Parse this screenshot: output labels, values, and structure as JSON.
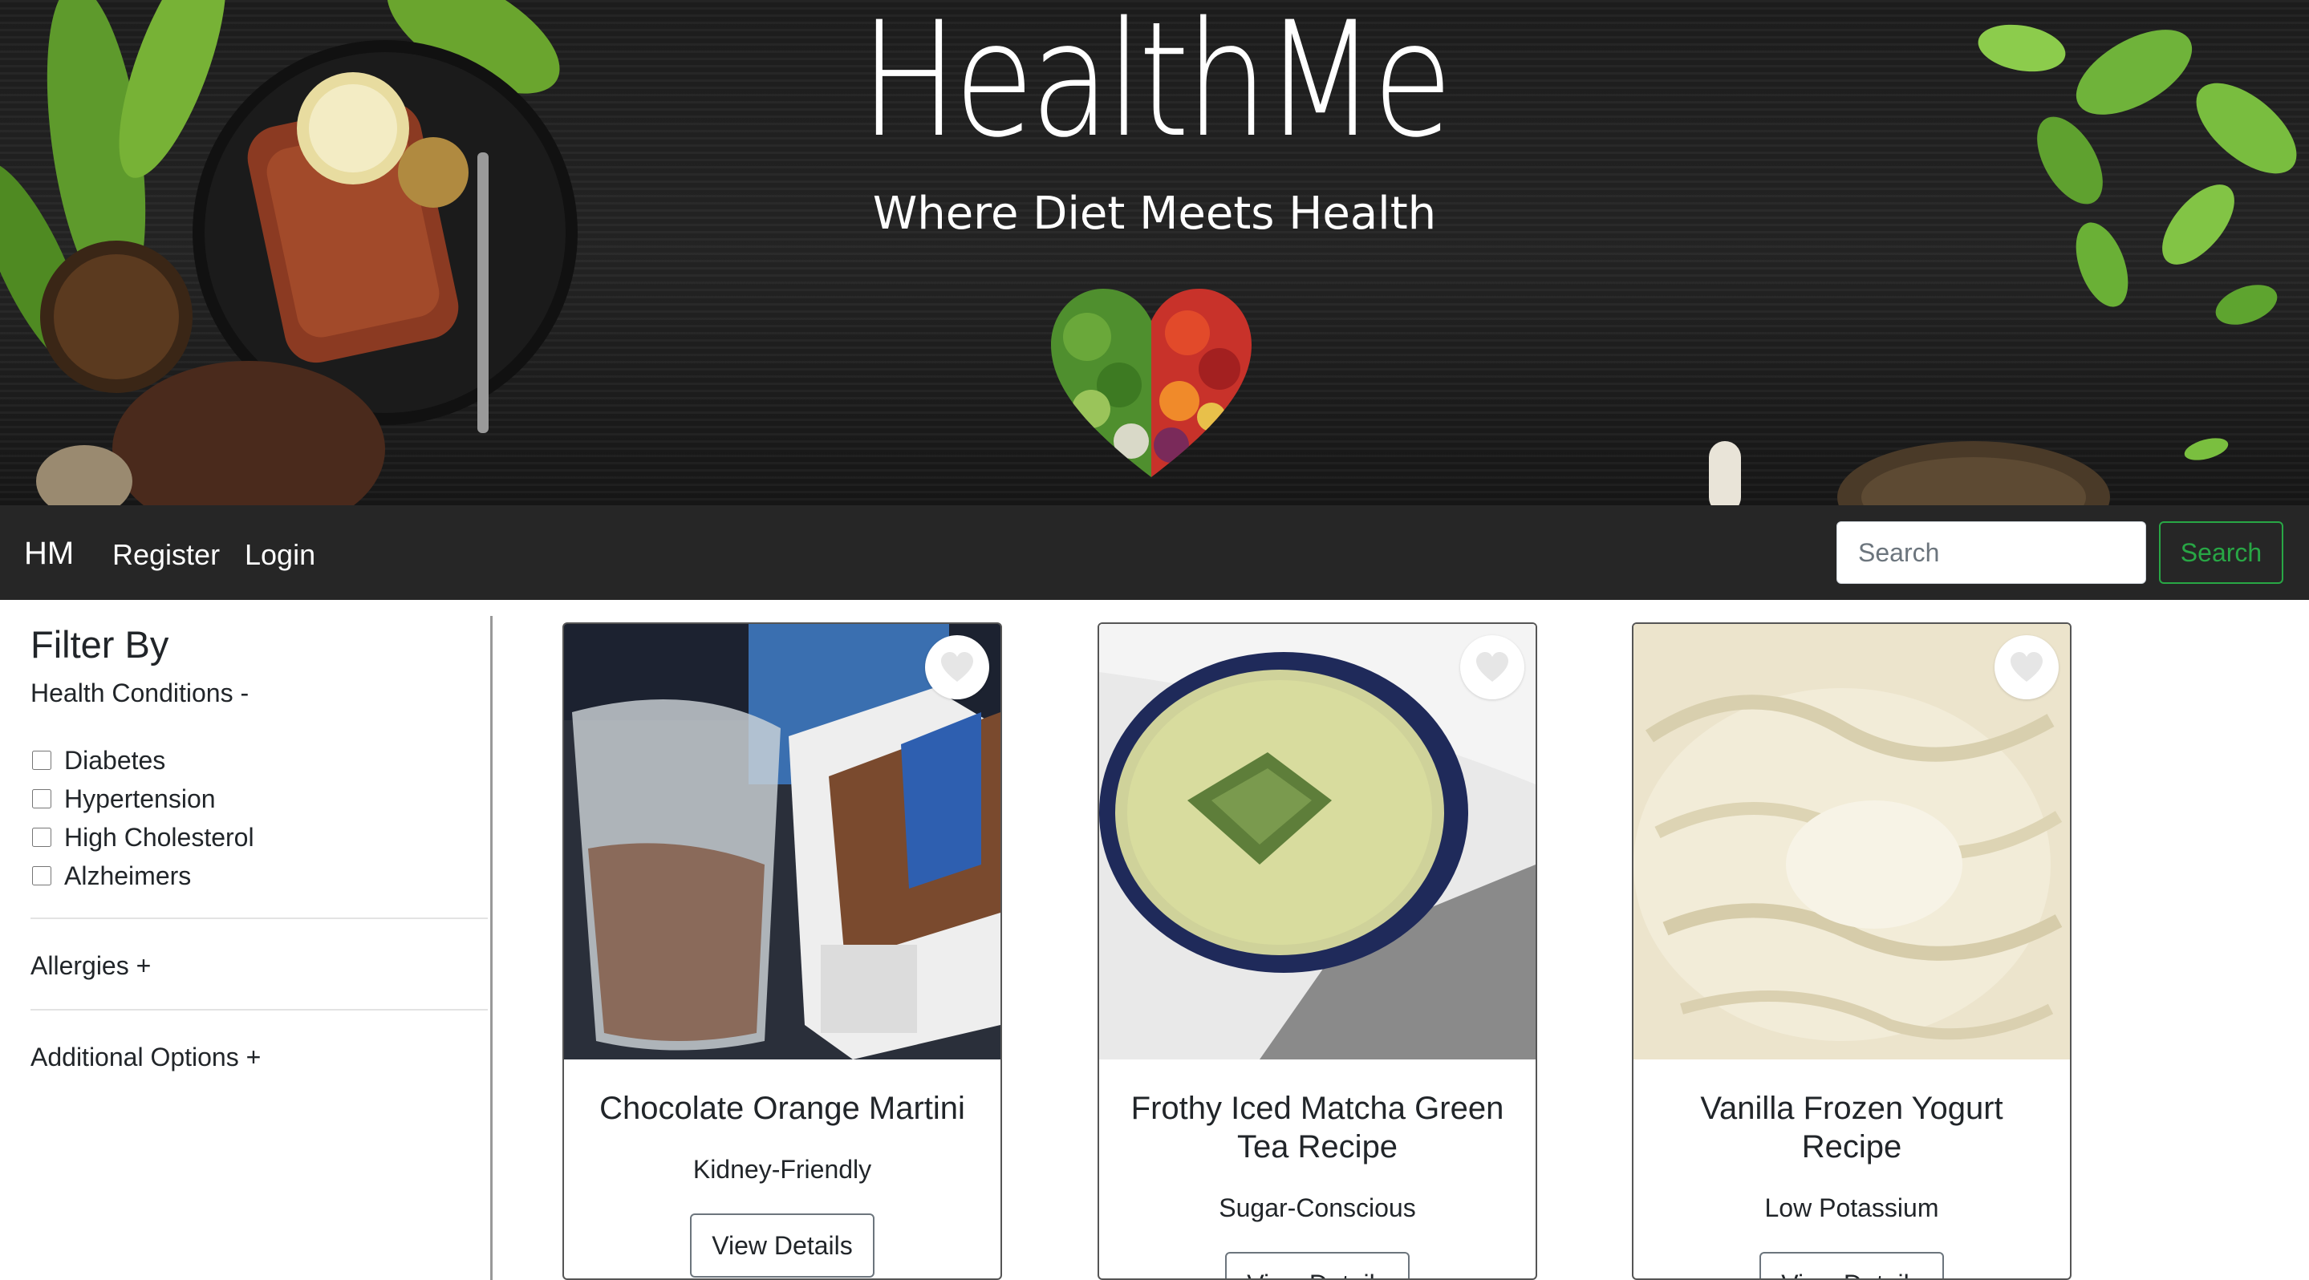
{
  "hero": {
    "title": "HealthMe",
    "subtitle": "Where Diet Meets Health"
  },
  "navbar": {
    "brand": "HM",
    "links": [
      "Register",
      "Login"
    ],
    "search": {
      "placeholder": "Search",
      "button_label": "Search"
    }
  },
  "sidebar": {
    "title": "Filter By",
    "health_conditions": {
      "label": "Health Conditions -",
      "options": [
        "Diabetes",
        "Hypertension",
        "High Cholesterol",
        "Alzheimers"
      ]
    },
    "allergies_label": "Allergies +",
    "additional_options_label": "Additional Options +"
  },
  "cards": [
    {
      "title": "Chocolate Orange Martini",
      "tag": "Kidney-Friendly",
      "button_label": "View Details",
      "favorite_icon": "heart-icon"
    },
    {
      "title": "Frothy Iced Matcha Green Tea Recipe",
      "tag": "Sugar-Conscious",
      "button_label": "View Details",
      "favorite_icon": "heart-icon"
    },
    {
      "title": "Vanilla Frozen Yogurt Recipe",
      "tag": "Low Potassium",
      "button_label": "View Details",
      "favorite_icon": "heart-icon"
    }
  ],
  "colors": {
    "navbar_bg": "#262626",
    "hero_bg": "#1c1c1c",
    "search_button": "#28a745",
    "sidebar_border": "#999999"
  }
}
